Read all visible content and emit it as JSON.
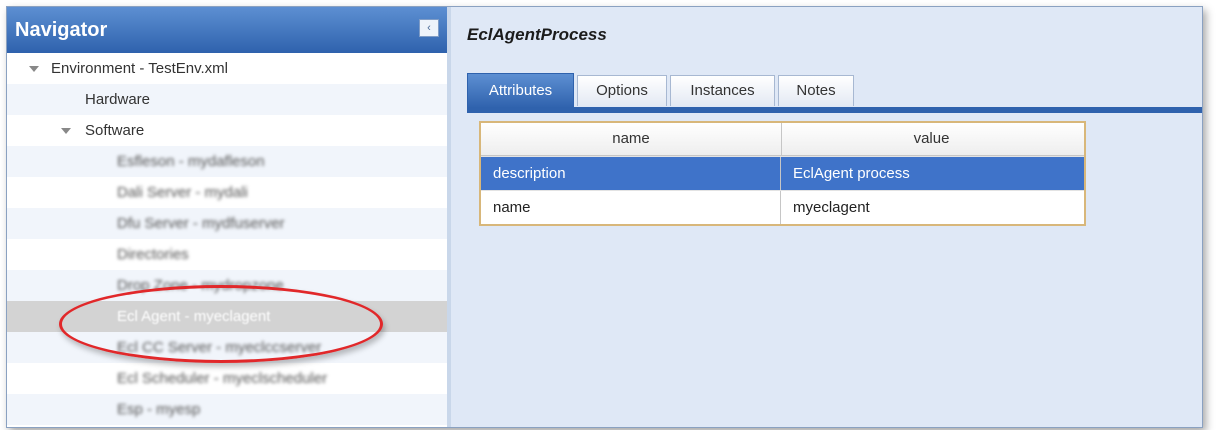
{
  "navigator": {
    "title": "Navigator",
    "collapse_glyph": "‹",
    "tree": [
      {
        "label": "Environment - TestEnv.xml",
        "expanded": true
      },
      {
        "label": "Hardware"
      },
      {
        "label": "Software",
        "expanded": true
      },
      {
        "label": "Esfleson - mydafleson"
      },
      {
        "label": "Dali Server - mydali"
      },
      {
        "label": "Dfu Server - mydfuserver"
      },
      {
        "label": "Directories"
      },
      {
        "label": "Drop Zone - mydropzone"
      },
      {
        "label": "Ecl Agent - myeclagent",
        "selected": true,
        "highlighted_by_annotation": true
      },
      {
        "label": "Ecl CC Server - myeclccserver"
      },
      {
        "label": "Ecl Scheduler - myeclscheduler"
      },
      {
        "label": "Esp - myesp"
      }
    ]
  },
  "content": {
    "title": "EclAgentProcess",
    "tabs": [
      {
        "label": "Attributes",
        "active": true
      },
      {
        "label": "Options"
      },
      {
        "label": "Instances"
      },
      {
        "label": "Notes"
      }
    ],
    "table": {
      "columns": [
        "name",
        "value"
      ],
      "rows": [
        {
          "name": "description",
          "value": "EclAgent process",
          "selected": true
        },
        {
          "name": "name",
          "value": "myeclagent"
        }
      ]
    }
  },
  "colors": {
    "header_blue": "#2f62ad",
    "selection_blue": "#3f73c9",
    "annotation_red": "#e1282a",
    "table_border": "#d8b77a"
  }
}
